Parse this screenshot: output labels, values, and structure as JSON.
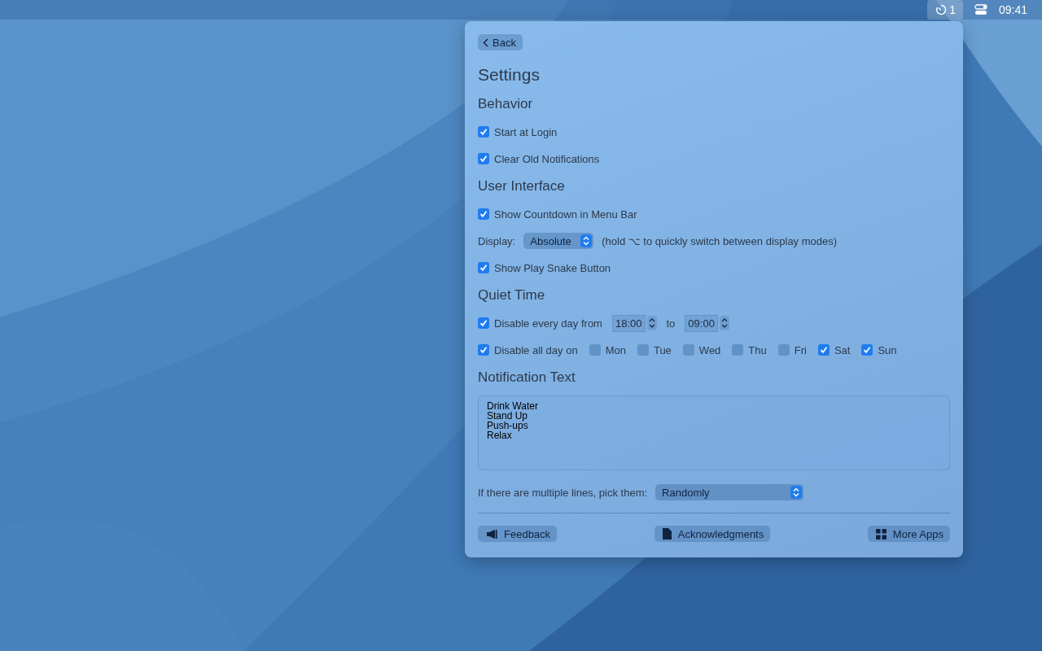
{
  "menu_bar": {
    "timer_count": "1",
    "time": "09:41"
  },
  "panel": {
    "back_button": "Back",
    "title": "Settings",
    "sections": [
      {
        "heading": "Behavior",
        "rows": [
          {
            "kind": "checkbox",
            "label": "Start at Login",
            "checked": true
          },
          {
            "kind": "checkbox",
            "label": "Clear Old Notifications",
            "checked": true
          }
        ]
      },
      {
        "heading": "User Interface",
        "rows": [
          {
            "kind": "checkbox",
            "label": "Show Countdown in Menu Bar",
            "checked": true
          },
          {
            "kind": "select",
            "label": "Display:",
            "value": "Absolute",
            "hint": "(hold ⌥ to quickly switch between display modes)"
          },
          {
            "kind": "checkbox",
            "label": "Show Play Snake Button",
            "checked": true
          }
        ]
      },
      {
        "heading": "Quiet Time",
        "rows": [
          {
            "kind": "time_range",
            "label": "Disable every day from",
            "checked": true,
            "from": "18:00",
            "separator": "to",
            "to": "09:00"
          },
          {
            "kind": "days",
            "label": "Disable all day on",
            "checked": true,
            "days": [
              {
                "label": "Mon",
                "checked": false
              },
              {
                "label": "Tue",
                "checked": false
              },
              {
                "label": "Wed",
                "checked": false
              },
              {
                "label": "Thu",
                "checked": false
              },
              {
                "label": "Fri",
                "checked": false
              },
              {
                "label": "Sat",
                "checked": true
              },
              {
                "label": "Sun",
                "checked": true
              }
            ]
          }
        ]
      },
      {
        "heading": "Notification Text",
        "rows": [
          {
            "kind": "textarea",
            "lines": [
              "Drink Water",
              "Stand Up",
              "Push-ups",
              "Relax"
            ]
          },
          {
            "kind": "wide_select",
            "label": "If there are multiple lines, pick them:",
            "value": "Randomly"
          }
        ]
      }
    ],
    "footer_buttons": [
      "Feedback",
      "Acknowledgments",
      "More Apps"
    ]
  }
}
